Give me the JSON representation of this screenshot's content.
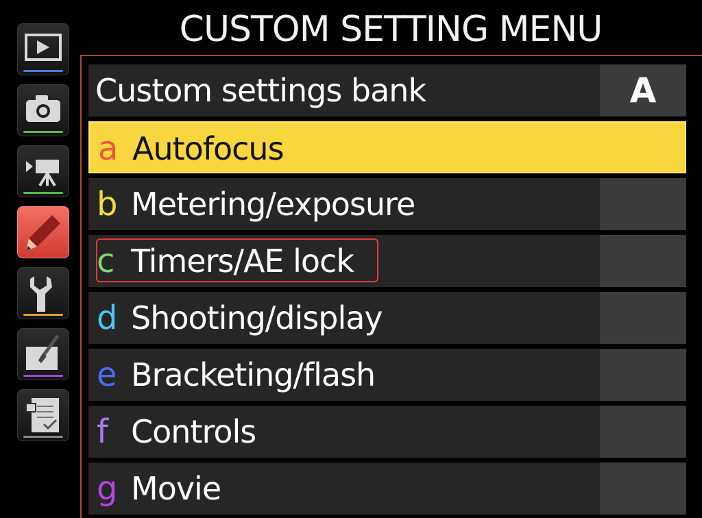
{
  "title": "CUSTOM SETTING MENU",
  "sidebar": {
    "tabs": [
      {
        "name": "playback-tab",
        "icon": "playback-icon",
        "bar_color": "#4a7be0"
      },
      {
        "name": "photo-shooting-tab",
        "icon": "camera-icon",
        "bar_color": "#5bbb4a"
      },
      {
        "name": "movie-shooting-tab",
        "icon": "movie-camera-icon",
        "bar_color": "#5bbb4a"
      },
      {
        "name": "custom-setting-tab",
        "icon": "pencil-icon",
        "bar_color": "#e8553f",
        "active": true
      },
      {
        "name": "setup-tab",
        "icon": "wrench-icon",
        "bar_color": "#e0a030"
      },
      {
        "name": "retouch-tab",
        "icon": "retouch-brush-icon",
        "bar_color": "#9a4ad8"
      },
      {
        "name": "my-menu-tab",
        "icon": "my-menu-icon",
        "bar_color": "#888888"
      }
    ]
  },
  "menu": {
    "bank": {
      "label": "Custom settings bank",
      "value": "A"
    },
    "items": [
      {
        "letter": "a",
        "label": "Autofocus",
        "letter_color": "#e85a3f",
        "selected": true
      },
      {
        "letter": "b",
        "label": "Metering/exposure",
        "letter_color": "#f0de3c"
      },
      {
        "letter": "c",
        "label": "Timers/AE lock",
        "letter_color": "#7ed86a"
      },
      {
        "letter": "d",
        "label": "Shooting/display",
        "letter_color": "#4ec3ee"
      },
      {
        "letter": "e",
        "label": "Bracketing/flash",
        "letter_color": "#4c6cf0"
      },
      {
        "letter": "f",
        "label": "Controls",
        "letter_color": "#a97be8"
      },
      {
        "letter": "g",
        "label": "Movie",
        "letter_color": "#b246e0"
      }
    ]
  },
  "colors": {
    "selected_row": "#f8d63f",
    "panel_border": "#b8443f",
    "highlight_outline": "#e23a3a"
  }
}
